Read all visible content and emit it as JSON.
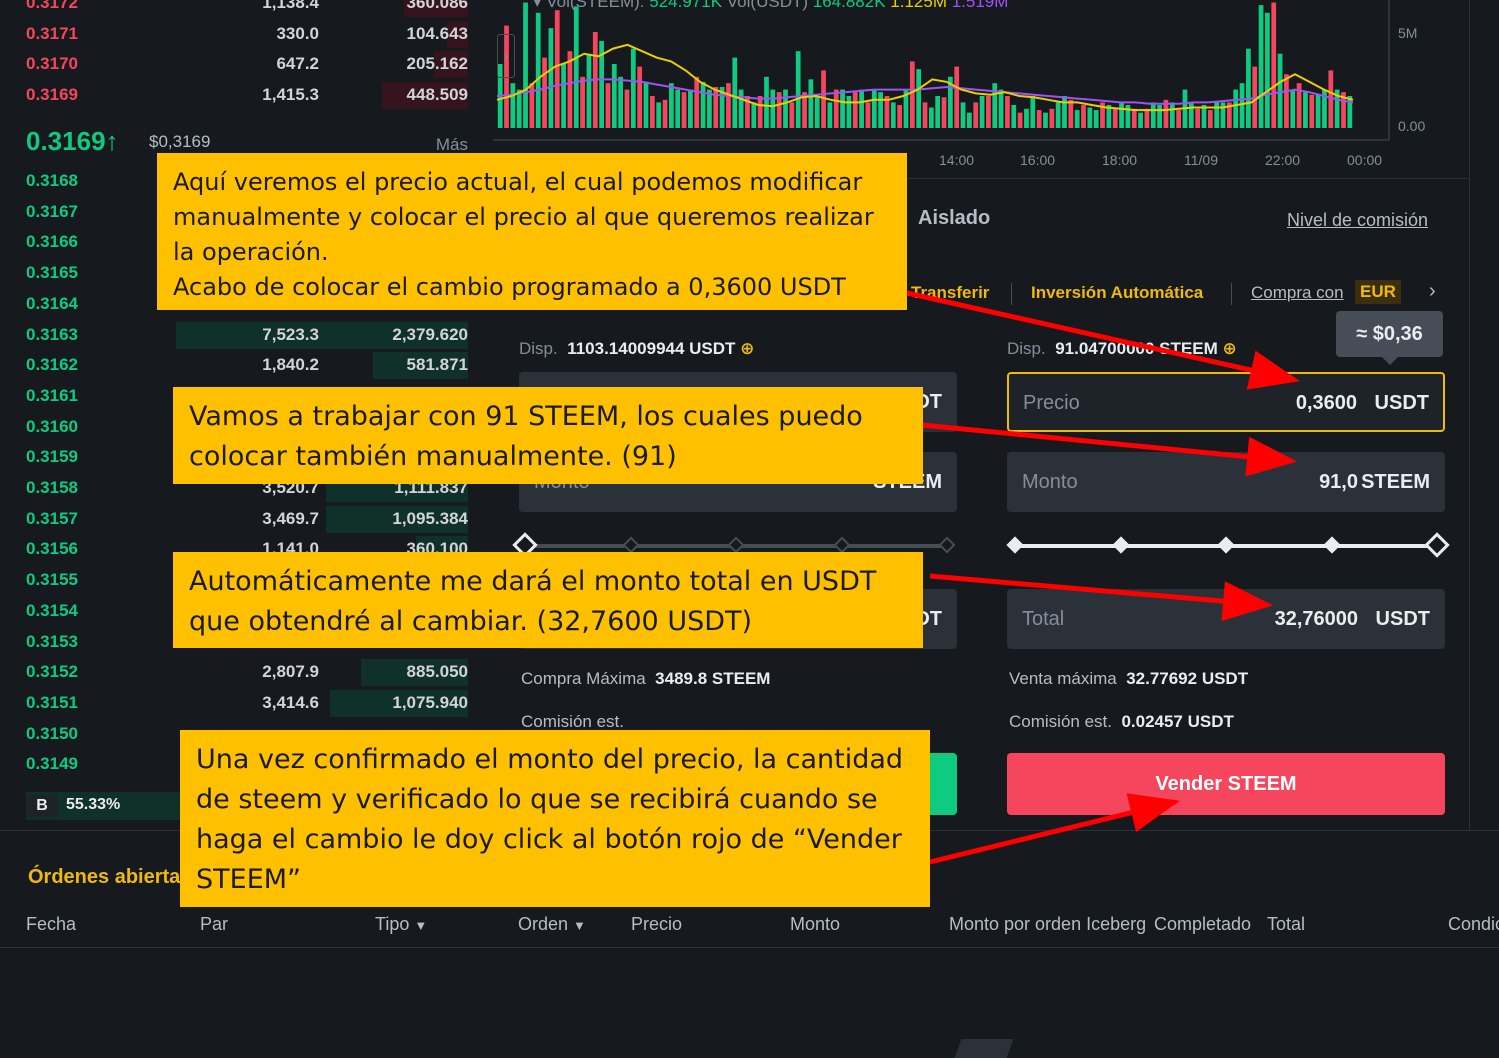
{
  "orderbook": {
    "asks": [
      {
        "price": "0.3172",
        "amount": "1,138.4",
        "total": "360.086",
        "depth": 0.15
      },
      {
        "price": "0.3171",
        "amount": "330.0",
        "total": "104.643",
        "depth": 0.05
      },
      {
        "price": "0.3170",
        "amount": "647.2",
        "total": "205.162",
        "depth": 0.08
      },
      {
        "price": "0.3169",
        "amount": "1,415.3",
        "total": "448.509",
        "depth": 0.2
      }
    ],
    "last_price": "0.3169↑",
    "last_price_usd": "$0,3169",
    "more_label": "Más",
    "bids": [
      {
        "price": "0.3168",
        "amount": "",
        "total": "",
        "depth": 0.0
      },
      {
        "price": "0.3167",
        "amount": "",
        "total": "",
        "depth": 0.0
      },
      {
        "price": "0.3166",
        "amount": "",
        "total": "",
        "depth": 0.0
      },
      {
        "price": "0.3165",
        "amount": "",
        "total": "",
        "depth": 0.0
      },
      {
        "price": "0.3164",
        "amount": "",
        "total": "",
        "depth": 0.0
      },
      {
        "price": "0.3163",
        "amount": "7,523.3",
        "total": "2,379.620",
        "depth": 0.68
      },
      {
        "price": "0.3162",
        "amount": "1,840.2",
        "total": "581.871",
        "depth": 0.22
      },
      {
        "price": "0.3161",
        "amount": "",
        "total": "",
        "depth": 0.0
      },
      {
        "price": "0.3160",
        "amount": "",
        "total": "",
        "depth": 0.0
      },
      {
        "price": "0.3159",
        "amount": "",
        "total": "",
        "depth": 0.0
      },
      {
        "price": "0.3158",
        "amount": "3,520.7",
        "total": "1,111.837",
        "depth": 0.33
      },
      {
        "price": "0.3157",
        "amount": "3,469.7",
        "total": "1,095.384",
        "depth": 0.33
      },
      {
        "price": "0.3156",
        "amount": "1,141.0",
        "total": "360.100",
        "depth": 0.12
      },
      {
        "price": "0.3155",
        "amount": "",
        "total": "",
        "depth": 0.0
      },
      {
        "price": "0.3154",
        "amount": "",
        "total": "",
        "depth": 0.0
      },
      {
        "price": "0.3153",
        "amount": "",
        "total": "",
        "depth": 0.0
      },
      {
        "price": "0.3152",
        "amount": "2,807.9",
        "total": "885.050",
        "depth": 0.25
      },
      {
        "price": "0.3151",
        "amount": "3,414.6",
        "total": "1,075.940",
        "depth": 0.32
      },
      {
        "price": "0.3150",
        "amount": "",
        "total": "",
        "depth": 0.0
      },
      {
        "price": "0.3149",
        "amount": "",
        "total": "",
        "depth": 0.0
      }
    ],
    "buy_ratio_label": "B",
    "buy_ratio": "55.33%"
  },
  "chart": {
    "legend": {
      "vol_steem_label": "Vol(STEEM):",
      "vol_steem_value": "524.971K",
      "vol_usdt_label": "Vol(USDT)",
      "vol_usdt_value": "164.882K",
      "ma1_value": "1.125M",
      "ma2_value": "1.519M"
    },
    "toggle_icon": "chevron-right-icon",
    "y_axis_labels": [
      "5M",
      "0.00"
    ],
    "x_axis_labels": [
      "14:00",
      "16:00",
      "18:00",
      "11/09",
      "22:00",
      "00:00"
    ],
    "volume_bars": [
      0.5,
      0.8,
      0.35,
      0.3,
      0.98,
      0.35,
      0.9,
      0.55,
      0.78,
      0.92,
      0.5,
      0.6,
      0.95,
      0.4,
      0.58,
      0.75,
      0.68,
      0.35,
      0.5,
      0.4,
      0.3,
      0.62,
      0.48,
      0.36,
      0.25,
      0.2,
      0.22,
      0.35,
      0.3,
      0.28,
      0.3,
      0.4,
      0.36,
      0.3,
      0.32,
      0.32,
      0.35,
      0.55,
      0.3,
      0.25,
      0.2,
      0.25,
      0.4,
      0.3,
      0.28,
      0.3,
      0.2,
      0.6,
      0.28,
      0.38,
      0.25,
      0.45,
      0.2,
      0.3,
      0.3,
      0.25,
      0.28,
      0.3,
      0.2,
      0.3,
      0.28,
      0.25,
      0.2,
      0.18,
      0.3,
      0.52,
      0.46,
      0.2,
      0.16,
      0.25,
      0.24,
      0.4,
      0.48,
      0.2,
      0.12,
      0.2,
      0.25,
      0.25,
      0.35,
      0.3,
      0.25,
      0.18,
      0.12,
      0.15,
      0.25,
      0.14,
      0.12,
      0.15,
      0.2,
      0.25,
      0.22,
      0.14,
      0.18,
      0.16,
      0.14,
      0.2,
      0.18,
      0.16,
      0.2,
      0.18,
      0.15,
      0.12,
      0.15,
      0.2,
      0.18,
      0.22,
      0.2,
      0.14,
      0.3,
      0.2,
      0.15,
      0.18,
      0.14,
      0.2,
      0.2,
      0.2,
      0.3,
      0.35,
      0.62,
      0.48,
      0.96,
      0.9,
      0.98,
      0.58,
      0.42,
      0.3,
      0.35,
      0.28,
      0.26,
      0.26,
      0.3,
      0.45,
      0.3,
      0.28,
      0.25
    ],
    "volume_up": [
      1,
      0,
      1,
      1,
      1,
      0,
      1,
      0,
      1,
      0,
      1,
      0,
      1,
      0,
      1,
      0,
      1,
      0,
      1,
      1,
      0,
      1,
      0,
      1,
      0,
      1,
      0,
      1,
      1,
      0,
      1,
      0,
      1,
      1,
      0,
      1,
      0,
      1,
      1,
      0,
      1,
      0,
      1,
      1,
      0,
      1,
      0,
      1,
      0,
      1,
      1,
      0,
      1,
      0,
      1,
      1,
      0,
      1,
      0,
      1,
      1,
      0,
      1,
      0,
      1,
      0,
      1,
      0,
      1,
      1,
      0,
      1,
      0,
      1,
      1,
      0,
      1,
      0,
      1,
      1,
      0,
      1,
      0,
      1,
      1,
      0,
      1,
      0,
      1,
      1,
      0,
      1,
      0,
      1,
      1,
      0,
      1,
      0,
      1,
      1,
      0,
      1,
      0,
      1,
      1,
      0,
      1,
      0,
      1,
      1,
      0,
      1,
      0,
      1,
      1,
      0,
      1,
      1,
      1,
      0,
      1,
      1,
      0,
      1,
      0,
      1,
      0,
      1,
      0,
      1,
      1,
      0,
      1,
      0,
      1
    ],
    "ma_fast": [
      0.22,
      0.25,
      0.3,
      0.4,
      0.48,
      0.52,
      0.58,
      0.56,
      0.62,
      0.65,
      0.6,
      0.55,
      0.52,
      0.45,
      0.36,
      0.3,
      0.26,
      0.22,
      0.18,
      0.17,
      0.2,
      0.24,
      0.25,
      0.22,
      0.2,
      0.2,
      0.22,
      0.22,
      0.25,
      0.3,
      0.38,
      0.36,
      0.3,
      0.27,
      0.26,
      0.28,
      0.25,
      0.24,
      0.22,
      0.2,
      0.2,
      0.18,
      0.16,
      0.15,
      0.14,
      0.14,
      0.14,
      0.15,
      0.16,
      0.16,
      0.16,
      0.18,
      0.2,
      0.28,
      0.36,
      0.42,
      0.36,
      0.3,
      0.25,
      0.22
    ],
    "ma_slow": [
      0.25,
      0.26,
      0.28,
      0.3,
      0.33,
      0.35,
      0.37,
      0.38,
      0.38,
      0.37,
      0.36,
      0.34,
      0.32,
      0.3,
      0.28,
      0.26,
      0.25,
      0.24,
      0.23,
      0.23,
      0.24,
      0.25,
      0.26,
      0.27,
      0.28,
      0.29,
      0.3,
      0.3,
      0.3,
      0.3,
      0.31,
      0.32,
      0.31,
      0.3,
      0.29,
      0.28,
      0.27,
      0.26,
      0.25,
      0.24,
      0.23,
      0.22,
      0.21,
      0.2,
      0.2,
      0.19,
      0.19,
      0.19,
      0.2,
      0.2,
      0.21,
      0.22,
      0.23,
      0.26,
      0.28,
      0.3,
      0.28,
      0.25,
      0.22,
      0.2
    ],
    "colors": {
      "up": "#0ecb81",
      "down": "#f6465d",
      "ma_fast": "#e8d000",
      "ma_slow": "#a052f5"
    }
  },
  "trade": {
    "tab_isolated": "Aislado",
    "fee_level": "Nivel de comisión",
    "link_transfer": "Transferir",
    "link_auto_invest": "Inversión Automática",
    "link_buy_with": "Compra con",
    "currency_badge": "EUR",
    "buy": {
      "avail_label": "Disp.",
      "avail_value": "1103.14009944 USDT",
      "price_unit": "DT",
      "amount_label": "Monto",
      "amount_unit": "STEEM",
      "total_unit": "DT",
      "max_label": "Compra Máxima",
      "max_value": "3489.8 STEEM",
      "fee_label": "Comisión est.",
      "slider_level": 0
    },
    "sell": {
      "avail_label": "Disp.",
      "avail_value": "91.04700000 STEEM",
      "price_label": "Precio",
      "price_value": "0,3600",
      "price_unit": "USDT",
      "price_tooltip": "≈ $0,36",
      "amount_label": "Monto",
      "amount_value": "91,0",
      "amount_unit": "STEEM",
      "total_label": "Total",
      "total_value": "32,76000",
      "total_unit": "USDT",
      "max_label": "Venta máxima",
      "max_value": "32.77692 USDT",
      "fee_label": "Comisión est.",
      "fee_value": "0.02457 USDT",
      "button": "Vender STEEM",
      "slider_level": 1
    }
  },
  "open_orders": {
    "title": "Órdenes abiertas",
    "columns": [
      "Fecha",
      "Par",
      "Tipo",
      "Orden",
      "Precio",
      "Monto",
      "Monto por orden Iceberg",
      "Completado",
      "Total",
      "Condic"
    ]
  },
  "annotations": {
    "note_1": "Aquí veremos el precio actual, el cual podemos modificar manualmente y colocar el precio al que queremos realizar la operación.\nAcabo de colocar el cambio programado a 0,3600 USDT",
    "note_2": "Vamos a trabajar con 91 STEEM, los cuales puedo colocar también manualmente. (91)",
    "note_3": "Automáticamente me dará el monto total en USDT que obtendré al cambiar. (32,7600 USDT)",
    "note_4": "Una vez confirmado el monto del precio, la cantidad de steem y verificado lo que se recibirá cuando se haga el cambio le doy click al botón rojo de “Vender STEEM”"
  }
}
